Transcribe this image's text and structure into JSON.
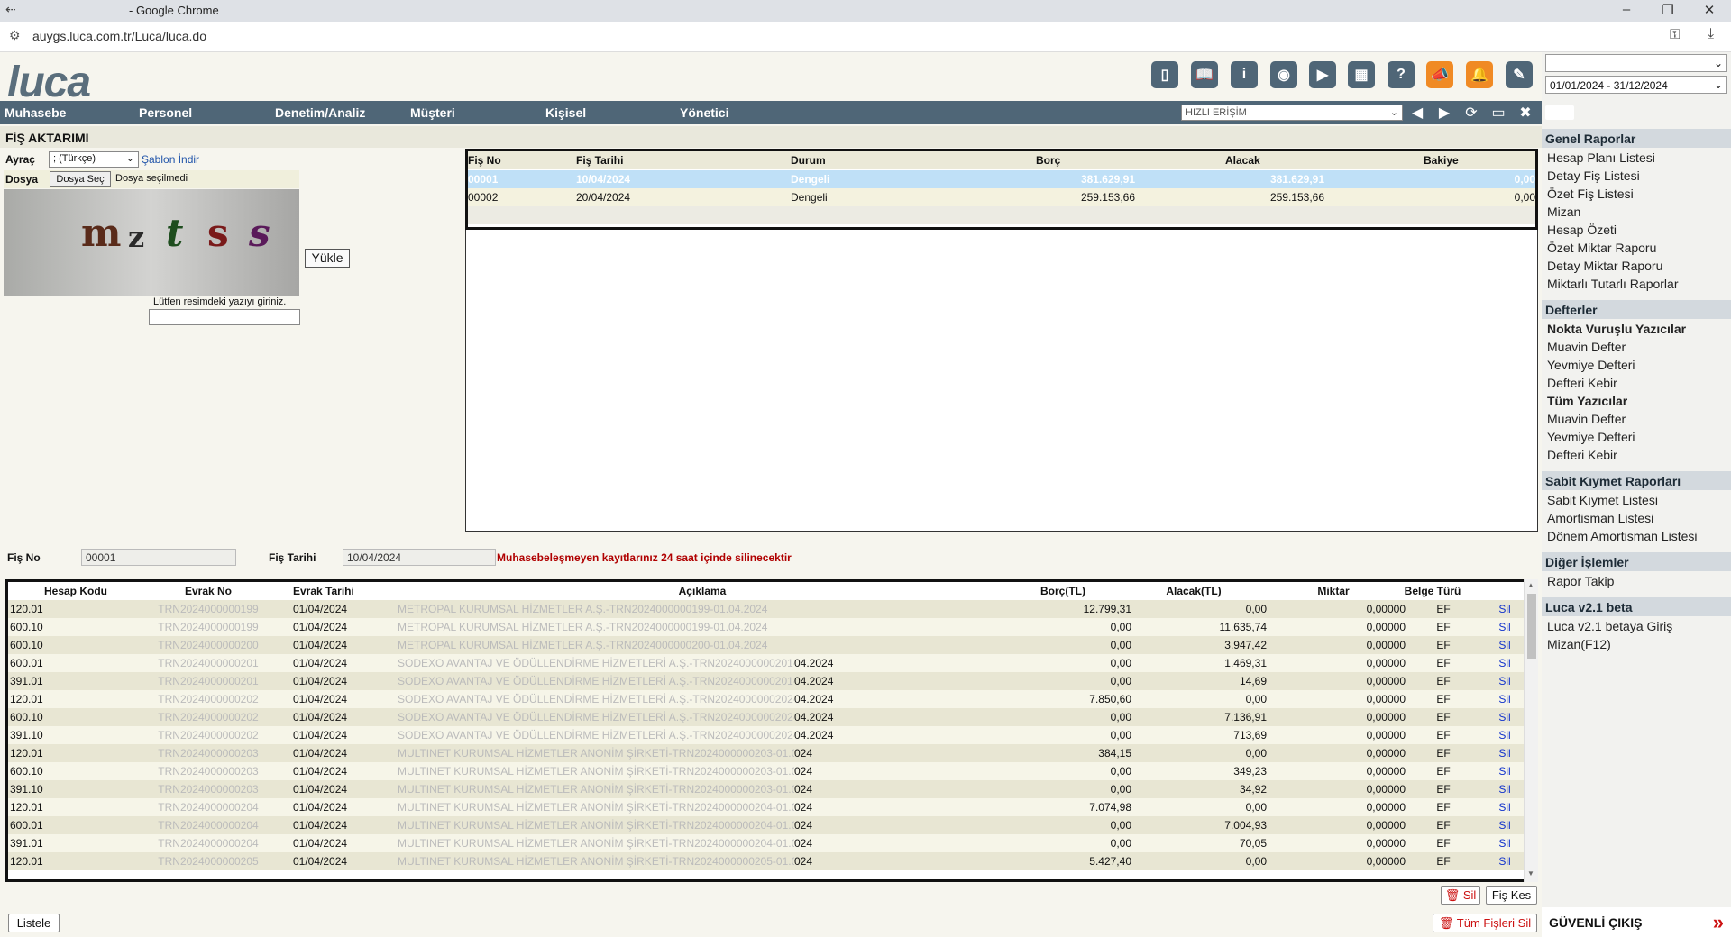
{
  "browser": {
    "title": "- Google Chrome",
    "url": "auygs.luca.com.tr/Luca/luca.do"
  },
  "app": {
    "logo": "luca"
  },
  "toolbar_icons": [
    "notes-icon",
    "book-icon",
    "info-icon",
    "globe-icon",
    "youtube-icon",
    "calculator-icon",
    "help-icon",
    "megaphone-icon",
    "bell-icon",
    "notebook-icon"
  ],
  "nav": {
    "items": [
      "Muhasebe",
      "Personel",
      "Denetim/Analiz",
      "Müşteri",
      "Kişisel",
      "Yönetici"
    ],
    "quick_access": "HIZLI ERİŞİM"
  },
  "right": {
    "company_select": "",
    "period_select": "01/01/2024 - 31/12/2024",
    "sections": [
      {
        "title": "Genel Raporlar",
        "items": [
          {
            "label": "Hesap Planı Listesi",
            "bold": false
          },
          {
            "label": "Detay Fiş Listesi",
            "bold": false
          },
          {
            "label": "Özet Fiş Listesi",
            "bold": false
          },
          {
            "label": "Mizan",
            "bold": false
          },
          {
            "label": "Hesap Özeti",
            "bold": false
          },
          {
            "label": "Özet Miktar Raporu",
            "bold": false
          },
          {
            "label": "Detay Miktar Raporu",
            "bold": false
          },
          {
            "label": "Miktarlı Tutarlı Raporlar",
            "bold": false
          }
        ]
      },
      {
        "title": "Defterler",
        "items": [
          {
            "label": "Nokta Vuruşlu Yazıcılar",
            "bold": true
          },
          {
            "label": "Muavin Defter",
            "bold": false
          },
          {
            "label": "Yevmiye Defteri",
            "bold": false
          },
          {
            "label": "Defteri Kebir",
            "bold": false
          },
          {
            "label": "Tüm Yazıcılar",
            "bold": true
          },
          {
            "label": "Muavin Defter",
            "bold": false
          },
          {
            "label": "Yevmiye Defteri",
            "bold": false
          },
          {
            "label": "Defteri Kebir",
            "bold": false
          }
        ]
      },
      {
        "title": "Sabit Kıymet Raporları",
        "items": [
          {
            "label": "Sabit Kıymet Listesi",
            "bold": false
          },
          {
            "label": "Amortisman Listesi",
            "bold": false
          },
          {
            "label": "Dönem Amortisman Listesi",
            "bold": false
          }
        ]
      },
      {
        "title": "Diğer İşlemler",
        "items": [
          {
            "label": "Rapor Takip",
            "bold": false
          }
        ]
      },
      {
        "title": "Luca v2.1 beta",
        "items": [
          {
            "label": "Luca v2.1 betaya Giriş",
            "bold": false
          },
          {
            "label": "Mizan(F12)",
            "bold": false
          }
        ]
      }
    ],
    "logout": "GÜVENLİ ÇIKIŞ"
  },
  "main": {
    "title": "FİŞ AKTARIMI",
    "ayrac_label": "Ayraç",
    "ayrac_value": "; (Türkçe)",
    "sablon_link": "Şablon İndir",
    "dosya_label": "Dosya",
    "dosya_button": "Dosya Seç",
    "dosya_status": "Dosya seçilmedi",
    "captcha_chars": [
      "m",
      "z",
      "t",
      "s",
      "s"
    ],
    "yukle_button": "Yükle",
    "captcha_hint": "Lütfen resimdeki yazıyı giriniz.",
    "top_table": {
      "headers": [
        "Fiş No",
        "Fiş Tarihi",
        "Durum",
        "Borç",
        "Alacak",
        "Bakiye"
      ],
      "rows": [
        {
          "fis_no": "00001",
          "tarih": "10/04/2024",
          "durum": "Dengeli",
          "borc": "381.629,91",
          "alacak": "381.629,91",
          "bakiye": "0,00",
          "selected": true
        },
        {
          "fis_no": "00002",
          "tarih": "20/04/2024",
          "durum": "Dengeli",
          "borc": "259.153,66",
          "alacak": "259.153,66",
          "bakiye": "0,00",
          "selected": false
        }
      ]
    },
    "fis_no_label": "Fiş No",
    "fis_no_value": "00001",
    "fis_tarihi_label": "Fiş Tarihi",
    "fis_tarihi_value": "10/04/2024",
    "warning": "Muhasebeleşmeyen kayıtlarınız 24 saat içinde silinecektir",
    "detail_table": {
      "headers": [
        "Hesap Kodu",
        "Evrak No",
        "Evrak Tarihi",
        "Açıklama",
        "Borç(TL)",
        "Alacak(TL)",
        "Miktar",
        "Belge Türü"
      ],
      "rows": [
        {
          "hesap": "120.01",
          "evrak": "TRN2024000000199",
          "tarih": "01/04/2024",
          "aciklama": "METROPAL KURUMSAL HİZMETLER A.Ş.-TRN2024000000199-01.04.2024",
          "tail": "",
          "borc": "12.799,31",
          "alacak": "0,00",
          "miktar": "0,00000",
          "belge": "EF",
          "sil": "Sil"
        },
        {
          "hesap": "600.10",
          "evrak": "TRN2024000000199",
          "tarih": "01/04/2024",
          "aciklama": "METROPAL KURUMSAL HİZMETLER A.Ş.-TRN2024000000199-01.04.2024",
          "tail": "",
          "borc": "0,00",
          "alacak": "11.635,74",
          "miktar": "0,00000",
          "belge": "EF",
          "sil": "Sil"
        },
        {
          "hesap": "600.10",
          "evrak": "TRN2024000000200",
          "tarih": "01/04/2024",
          "aciklama": "METROPAL KURUMSAL HİZMETLER A.Ş.-TRN2024000000200-01.04.2024",
          "tail": "",
          "borc": "0,00",
          "alacak": "3.947,42",
          "miktar": "0,00000",
          "belge": "EF",
          "sil": "Sil"
        },
        {
          "hesap": "600.01",
          "evrak": "TRN2024000000201",
          "tarih": "01/04/2024",
          "aciklama": "SODEXO AVANTAJ VE ÖDÜLLENDİRME HİZMETLERİ A.Ş.-TRN2024000000201-01",
          "tail": "04.2024",
          "borc": "0,00",
          "alacak": "1.469,31",
          "miktar": "0,00000",
          "belge": "EF",
          "sil": "Sil"
        },
        {
          "hesap": "391.01",
          "evrak": "TRN2024000000201",
          "tarih": "01/04/2024",
          "aciklama": "SODEXO AVANTAJ VE ÖDÜLLENDİRME HİZMETLERİ A.Ş.-TRN2024000000201-01",
          "tail": "04.2024",
          "borc": "0,00",
          "alacak": "14,69",
          "miktar": "0,00000",
          "belge": "EF",
          "sil": "Sil"
        },
        {
          "hesap": "120.01",
          "evrak": "TRN2024000000202",
          "tarih": "01/04/2024",
          "aciklama": "SODEXO AVANTAJ VE ÖDÜLLENDİRME HİZMETLERİ A.Ş.-TRN2024000000202-01",
          "tail": "04.2024",
          "borc": "7.850,60",
          "alacak": "0,00",
          "miktar": "0,00000",
          "belge": "EF",
          "sil": "Sil"
        },
        {
          "hesap": "600.10",
          "evrak": "TRN2024000000202",
          "tarih": "01/04/2024",
          "aciklama": "SODEXO AVANTAJ VE ÖDÜLLENDİRME HİZMETLERİ A.Ş.-TRN2024000000202-01",
          "tail": "04.2024",
          "borc": "0,00",
          "alacak": "7.136,91",
          "miktar": "0,00000",
          "belge": "EF",
          "sil": "Sil"
        },
        {
          "hesap": "391.10",
          "evrak": "TRN2024000000202",
          "tarih": "01/04/2024",
          "aciklama": "SODEXO AVANTAJ VE ÖDÜLLENDİRME HİZMETLERİ A.Ş.-TRN2024000000202-01",
          "tail": "04.2024",
          "borc": "0,00",
          "alacak": "713,69",
          "miktar": "0,00000",
          "belge": "EF",
          "sil": "Sil"
        },
        {
          "hesap": "120.01",
          "evrak": "TRN2024000000203",
          "tarih": "01/04/2024",
          "aciklama": "MULTINET KURUMSAL HİZMETLER ANONİM ŞİRKETİ-TRN2024000000203-01.04.",
          "tail": "024",
          "borc": "384,15",
          "alacak": "0,00",
          "miktar": "0,00000",
          "belge": "EF",
          "sil": "Sil"
        },
        {
          "hesap": "600.10",
          "evrak": "TRN2024000000203",
          "tarih": "01/04/2024",
          "aciklama": "MULTINET KURUMSAL HİZMETLER ANONİM ŞİRKETİ-TRN2024000000203-01.04.",
          "tail": "024",
          "borc": "0,00",
          "alacak": "349,23",
          "miktar": "0,00000",
          "belge": "EF",
          "sil": "Sil"
        },
        {
          "hesap": "391.10",
          "evrak": "TRN2024000000203",
          "tarih": "01/04/2024",
          "aciklama": "MULTINET KURUMSAL HİZMETLER ANONİM ŞİRKETİ-TRN2024000000203-01.04.",
          "tail": "024",
          "borc": "0,00",
          "alacak": "34,92",
          "miktar": "0,00000",
          "belge": "EF",
          "sil": "Sil"
        },
        {
          "hesap": "120.01",
          "evrak": "TRN2024000000204",
          "tarih": "01/04/2024",
          "aciklama": "MULTINET KURUMSAL HİZMETLER ANONİM ŞİRKETİ-TRN2024000000204-01.04.",
          "tail": "024",
          "borc": "7.074,98",
          "alacak": "0,00",
          "miktar": "0,00000",
          "belge": "EF",
          "sil": "Sil"
        },
        {
          "hesap": "600.01",
          "evrak": "TRN2024000000204",
          "tarih": "01/04/2024",
          "aciklama": "MULTINET KURUMSAL HİZMETLER ANONİM ŞİRKETİ-TRN2024000000204-01.04.",
          "tail": "024",
          "borc": "0,00",
          "alacak": "7.004,93",
          "miktar": "0,00000",
          "belge": "EF",
          "sil": "Sil"
        },
        {
          "hesap": "391.01",
          "evrak": "TRN2024000000204",
          "tarih": "01/04/2024",
          "aciklama": "MULTINET KURUMSAL HİZMETLER ANONİM ŞİRKETİ-TRN2024000000204-01.04.",
          "tail": "024",
          "borc": "0,00",
          "alacak": "70,05",
          "miktar": "0,00000",
          "belge": "EF",
          "sil": "Sil"
        },
        {
          "hesap": "120.01",
          "evrak": "TRN2024000000205",
          "tarih": "01/04/2024",
          "aciklama": "MULTINET KURUMSAL HİZMETLER ANONİM ŞİRKETİ-TRN2024000000205-01.04.",
          "tail": "024",
          "borc": "5.427,40",
          "alacak": "0,00",
          "miktar": "0,00000",
          "belge": "EF",
          "sil": "Sil"
        }
      ]
    },
    "sil_button": "Sil",
    "fis_kes_button": "Fiş Kes",
    "listele_button": "Listele",
    "tum_sil_button": "Tüm Fişleri Sil"
  }
}
